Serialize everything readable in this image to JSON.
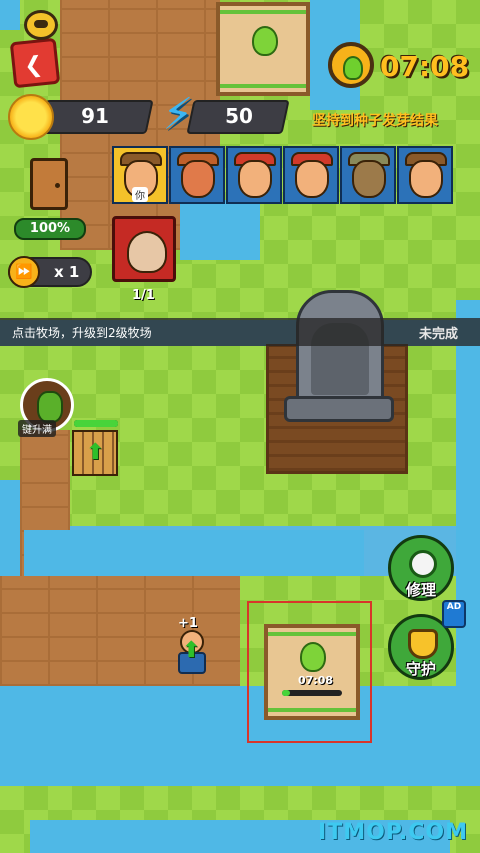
{
  "hud": {
    "sun_value": "91",
    "energy_value": "50",
    "timer": "07:08",
    "goal": "坚持到种子发芽结果",
    "hp_percent": "100%",
    "speed_label": "x 1",
    "skull_count": "1/1"
  },
  "characters": [
    {
      "name": "farmer-pitchfork",
      "tag": "你",
      "selected": true
    },
    {
      "name": "antler-girl",
      "tag": "",
      "selected": false
    },
    {
      "name": "red-cap-farmer",
      "tag": "",
      "selected": false
    },
    {
      "name": "mustache-farmer",
      "tag": "",
      "selected": false
    },
    {
      "name": "scarecrow-robot",
      "tag": "",
      "selected": false
    },
    {
      "name": "bearded-farmer",
      "tag": "",
      "selected": false
    }
  ],
  "task": {
    "text": "点击牧场，升级到2级牧场",
    "status": "未完成"
  },
  "hero": {
    "label": "键升满"
  },
  "farmer_gain": "+1",
  "crate_timer": "07:08",
  "actions": {
    "repair_label": "修理",
    "guard_label": "守护",
    "ad_label": "AD"
  },
  "watermark": "ITMOP.COM",
  "colors": {
    "accent_gold": "#ffbf1f",
    "hp_green": "#2c8a2a",
    "alert_red": "#d8352a"
  }
}
